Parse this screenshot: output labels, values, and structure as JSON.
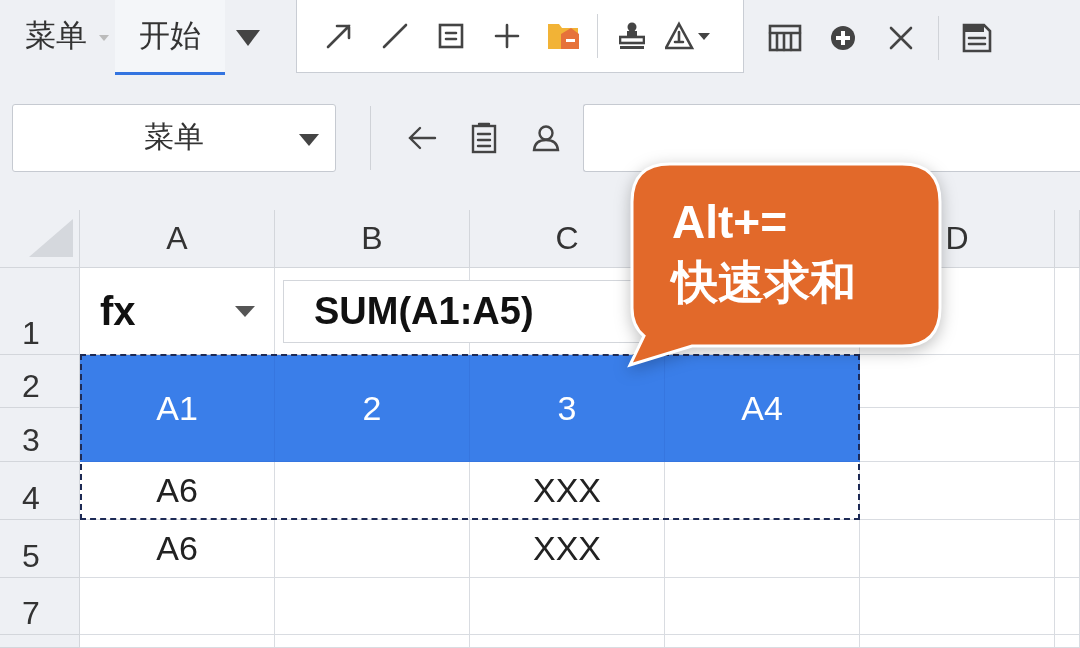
{
  "ribbon": {
    "tabs": [
      {
        "label": "菜单",
        "selected": false
      },
      {
        "label": "开始",
        "selected": true
      }
    ]
  },
  "formula_bar": {
    "name_box": "菜单"
  },
  "sheet": {
    "columns": [
      "A",
      "B",
      "C",
      null,
      "D"
    ],
    "row_numbers": [
      "1",
      "2",
      "3",
      "4",
      "5",
      "7"
    ],
    "function_box": "fx",
    "formula": "SUM(A1:A5)",
    "data_rows": [
      {
        "kind": "header",
        "cells": [
          "A1",
          "2",
          "3",
          "A4"
        ],
        "in_selection": true
      },
      {
        "kind": "plain",
        "cells": [
          "A6",
          null,
          "XXX",
          null
        ],
        "in_selection": true
      },
      {
        "kind": "plain",
        "cells": [
          "A6",
          null,
          "XXX",
          null
        ],
        "in_selection": false
      }
    ]
  },
  "callout": {
    "lines": [
      "Alt+=",
      "快速求和"
    ]
  }
}
